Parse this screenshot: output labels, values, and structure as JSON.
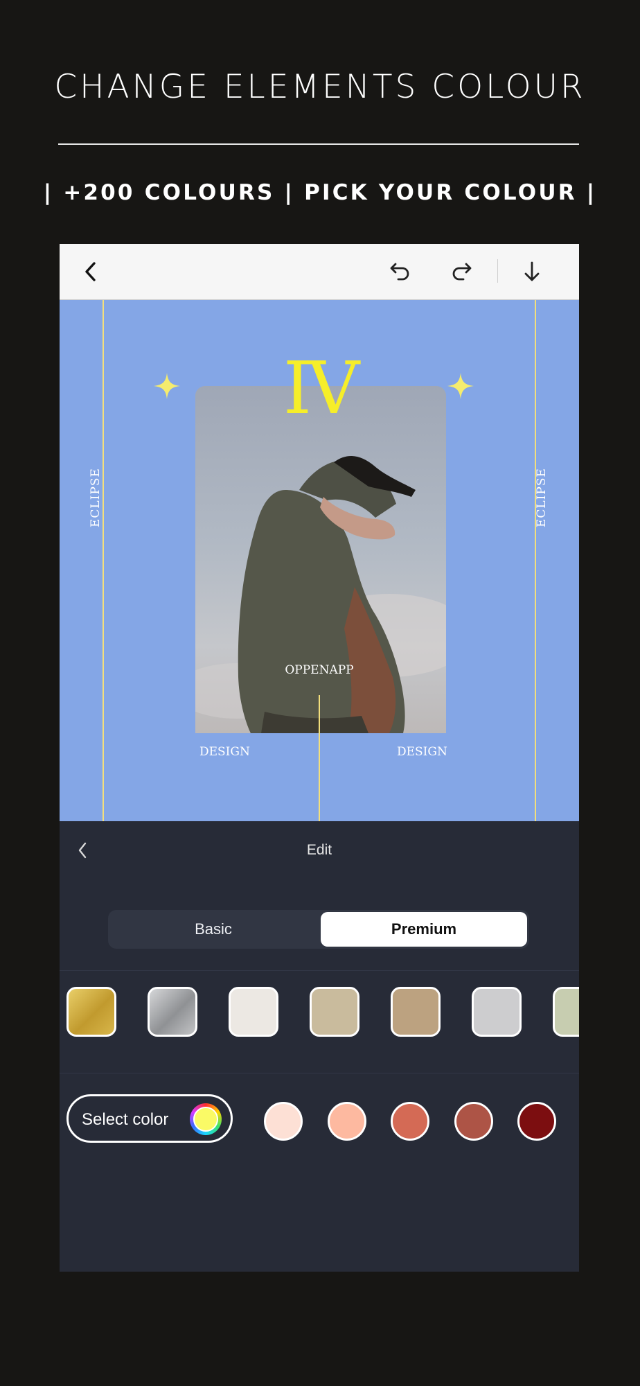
{
  "promo": {
    "headline": "CHANGE ELEMENTS COLOUR",
    "subheadline": "| +200 COLOURS | PICK YOUR COLOUR |"
  },
  "toolbar": {
    "back_icon": "chevron-left-icon",
    "undo_icon": "undo-icon",
    "redo_icon": "redo-icon",
    "download_icon": "download-arrow-icon"
  },
  "canvas": {
    "background_color": "#84a6e6",
    "accent_color": "#f6ee29",
    "numeral": "IV",
    "side_text_left": "ECLIPSE",
    "side_text_right": "ECLIPSE",
    "photo_label": "OPPENAPP",
    "bottom_left": "DESIGN",
    "bottom_right": "DESIGN"
  },
  "panel": {
    "title": "Edit",
    "tabs": {
      "basic": "Basic",
      "premium": "Premium",
      "selected": "Premium"
    },
    "texture_swatches": [
      {
        "name": "gold",
        "color": "#c9a93e"
      },
      {
        "name": "silver",
        "color": "#a9aaad"
      },
      {
        "name": "pearl",
        "color": "#ece8e3"
      },
      {
        "name": "sand",
        "color": "#c9bb9d"
      },
      {
        "name": "tan",
        "color": "#bca280"
      },
      {
        "name": "light-grey",
        "color": "#cdcdcf"
      },
      {
        "name": "sage",
        "color": "#c7cdb0"
      }
    ],
    "select_color_label": "Select color",
    "current_color": "#fafa66",
    "color_dots": [
      "#fde0d5",
      "#fdb9a0",
      "#d46a55",
      "#ad5446",
      "#7c0e10"
    ]
  }
}
